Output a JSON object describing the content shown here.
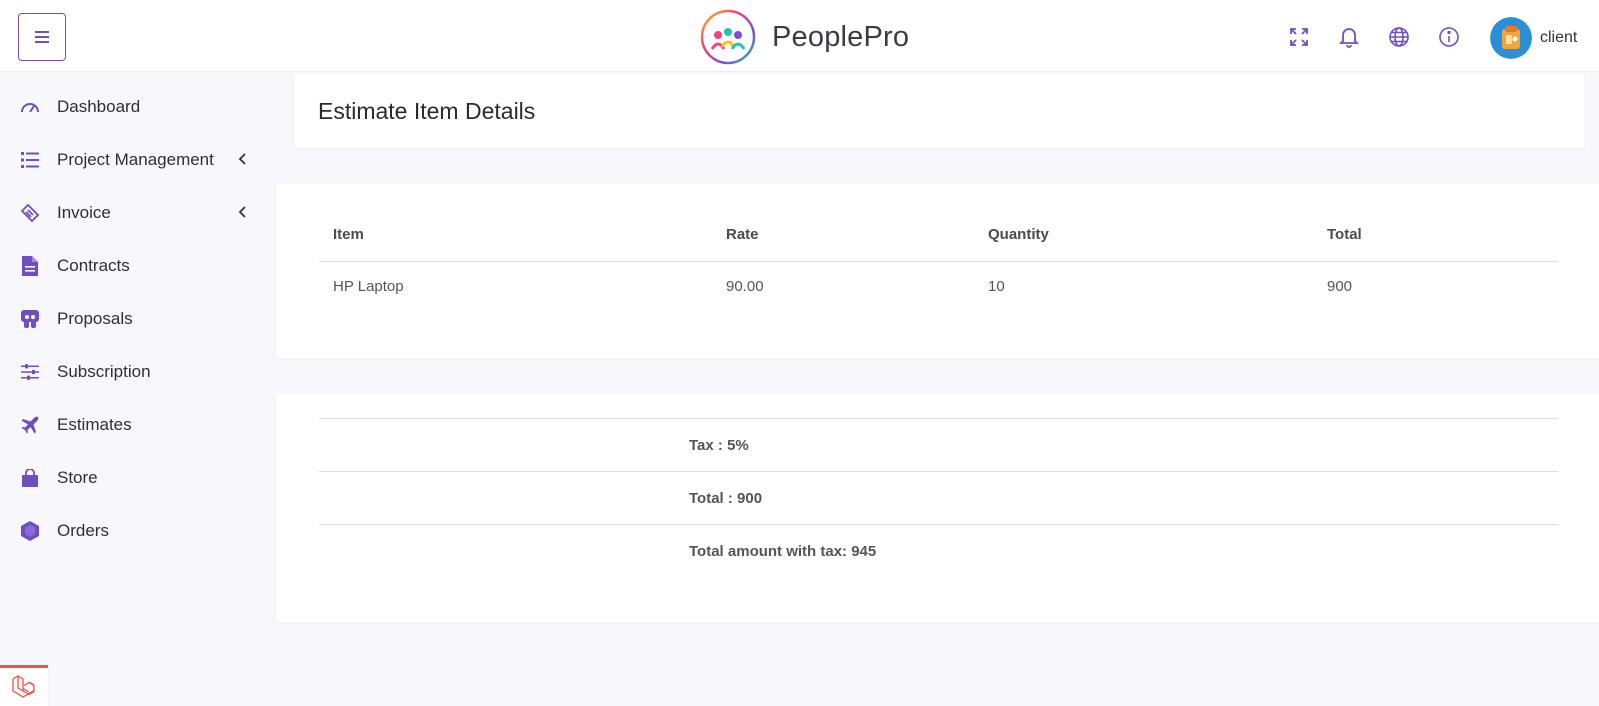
{
  "header": {
    "brand_name": "PeoplePro",
    "user_name": "client",
    "accent_color": "#6f4fbf"
  },
  "sidebar": {
    "items": [
      {
        "label": "Dashboard",
        "icon": "speedometer-icon"
      },
      {
        "label": "Project Management",
        "icon": "list-icon",
        "has_submenu": true
      },
      {
        "label": "Invoice",
        "icon": "ticket-icon",
        "has_submenu": true
      },
      {
        "label": "Contracts",
        "icon": "document-icon"
      },
      {
        "label": "Proposals",
        "icon": "proposal-icon"
      },
      {
        "label": "Subscription",
        "icon": "sliders-icon"
      },
      {
        "label": "Estimates",
        "icon": "plane-icon"
      },
      {
        "label": "Store",
        "icon": "shopping-bag-icon"
      },
      {
        "label": "Orders",
        "icon": "hexagon-icon"
      }
    ]
  },
  "main": {
    "title": "Estimate Item Details",
    "table": {
      "columns": [
        "Item",
        "Rate",
        "Quantity",
        "Total"
      ],
      "rows": [
        [
          "HP Laptop",
          "90.00",
          "10",
          "900"
        ]
      ]
    },
    "summary": {
      "tax": "Tax : 5%",
      "total": "Total : 900",
      "total_with_tax": "Total amount with tax: 945"
    }
  }
}
